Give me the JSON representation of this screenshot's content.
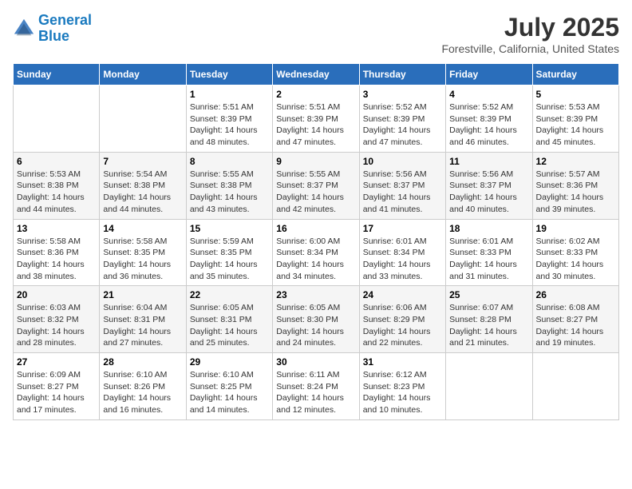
{
  "logo": {
    "line1": "General",
    "line2": "Blue"
  },
  "title": "July 2025",
  "subtitle": "Forestville, California, United States",
  "weekdays": [
    "Sunday",
    "Monday",
    "Tuesday",
    "Wednesday",
    "Thursday",
    "Friday",
    "Saturday"
  ],
  "weeks": [
    [
      {
        "day": "",
        "sunrise": "",
        "sunset": "",
        "daylight": ""
      },
      {
        "day": "",
        "sunrise": "",
        "sunset": "",
        "daylight": ""
      },
      {
        "day": "1",
        "sunrise": "Sunrise: 5:51 AM",
        "sunset": "Sunset: 8:39 PM",
        "daylight": "Daylight: 14 hours and 48 minutes."
      },
      {
        "day": "2",
        "sunrise": "Sunrise: 5:51 AM",
        "sunset": "Sunset: 8:39 PM",
        "daylight": "Daylight: 14 hours and 47 minutes."
      },
      {
        "day": "3",
        "sunrise": "Sunrise: 5:52 AM",
        "sunset": "Sunset: 8:39 PM",
        "daylight": "Daylight: 14 hours and 47 minutes."
      },
      {
        "day": "4",
        "sunrise": "Sunrise: 5:52 AM",
        "sunset": "Sunset: 8:39 PM",
        "daylight": "Daylight: 14 hours and 46 minutes."
      },
      {
        "day": "5",
        "sunrise": "Sunrise: 5:53 AM",
        "sunset": "Sunset: 8:39 PM",
        "daylight": "Daylight: 14 hours and 45 minutes."
      }
    ],
    [
      {
        "day": "6",
        "sunrise": "Sunrise: 5:53 AM",
        "sunset": "Sunset: 8:38 PM",
        "daylight": "Daylight: 14 hours and 44 minutes."
      },
      {
        "day": "7",
        "sunrise": "Sunrise: 5:54 AM",
        "sunset": "Sunset: 8:38 PM",
        "daylight": "Daylight: 14 hours and 44 minutes."
      },
      {
        "day": "8",
        "sunrise": "Sunrise: 5:55 AM",
        "sunset": "Sunset: 8:38 PM",
        "daylight": "Daylight: 14 hours and 43 minutes."
      },
      {
        "day": "9",
        "sunrise": "Sunrise: 5:55 AM",
        "sunset": "Sunset: 8:37 PM",
        "daylight": "Daylight: 14 hours and 42 minutes."
      },
      {
        "day": "10",
        "sunrise": "Sunrise: 5:56 AM",
        "sunset": "Sunset: 8:37 PM",
        "daylight": "Daylight: 14 hours and 41 minutes."
      },
      {
        "day": "11",
        "sunrise": "Sunrise: 5:56 AM",
        "sunset": "Sunset: 8:37 PM",
        "daylight": "Daylight: 14 hours and 40 minutes."
      },
      {
        "day": "12",
        "sunrise": "Sunrise: 5:57 AM",
        "sunset": "Sunset: 8:36 PM",
        "daylight": "Daylight: 14 hours and 39 minutes."
      }
    ],
    [
      {
        "day": "13",
        "sunrise": "Sunrise: 5:58 AM",
        "sunset": "Sunset: 8:36 PM",
        "daylight": "Daylight: 14 hours and 38 minutes."
      },
      {
        "day": "14",
        "sunrise": "Sunrise: 5:58 AM",
        "sunset": "Sunset: 8:35 PM",
        "daylight": "Daylight: 14 hours and 36 minutes."
      },
      {
        "day": "15",
        "sunrise": "Sunrise: 5:59 AM",
        "sunset": "Sunset: 8:35 PM",
        "daylight": "Daylight: 14 hours and 35 minutes."
      },
      {
        "day": "16",
        "sunrise": "Sunrise: 6:00 AM",
        "sunset": "Sunset: 8:34 PM",
        "daylight": "Daylight: 14 hours and 34 minutes."
      },
      {
        "day": "17",
        "sunrise": "Sunrise: 6:01 AM",
        "sunset": "Sunset: 8:34 PM",
        "daylight": "Daylight: 14 hours and 33 minutes."
      },
      {
        "day": "18",
        "sunrise": "Sunrise: 6:01 AM",
        "sunset": "Sunset: 8:33 PM",
        "daylight": "Daylight: 14 hours and 31 minutes."
      },
      {
        "day": "19",
        "sunrise": "Sunrise: 6:02 AM",
        "sunset": "Sunset: 8:33 PM",
        "daylight": "Daylight: 14 hours and 30 minutes."
      }
    ],
    [
      {
        "day": "20",
        "sunrise": "Sunrise: 6:03 AM",
        "sunset": "Sunset: 8:32 PM",
        "daylight": "Daylight: 14 hours and 28 minutes."
      },
      {
        "day": "21",
        "sunrise": "Sunrise: 6:04 AM",
        "sunset": "Sunset: 8:31 PM",
        "daylight": "Daylight: 14 hours and 27 minutes."
      },
      {
        "day": "22",
        "sunrise": "Sunrise: 6:05 AM",
        "sunset": "Sunset: 8:31 PM",
        "daylight": "Daylight: 14 hours and 25 minutes."
      },
      {
        "day": "23",
        "sunrise": "Sunrise: 6:05 AM",
        "sunset": "Sunset: 8:30 PM",
        "daylight": "Daylight: 14 hours and 24 minutes."
      },
      {
        "day": "24",
        "sunrise": "Sunrise: 6:06 AM",
        "sunset": "Sunset: 8:29 PM",
        "daylight": "Daylight: 14 hours and 22 minutes."
      },
      {
        "day": "25",
        "sunrise": "Sunrise: 6:07 AM",
        "sunset": "Sunset: 8:28 PM",
        "daylight": "Daylight: 14 hours and 21 minutes."
      },
      {
        "day": "26",
        "sunrise": "Sunrise: 6:08 AM",
        "sunset": "Sunset: 8:27 PM",
        "daylight": "Daylight: 14 hours and 19 minutes."
      }
    ],
    [
      {
        "day": "27",
        "sunrise": "Sunrise: 6:09 AM",
        "sunset": "Sunset: 8:27 PM",
        "daylight": "Daylight: 14 hours and 17 minutes."
      },
      {
        "day": "28",
        "sunrise": "Sunrise: 6:10 AM",
        "sunset": "Sunset: 8:26 PM",
        "daylight": "Daylight: 14 hours and 16 minutes."
      },
      {
        "day": "29",
        "sunrise": "Sunrise: 6:10 AM",
        "sunset": "Sunset: 8:25 PM",
        "daylight": "Daylight: 14 hours and 14 minutes."
      },
      {
        "day": "30",
        "sunrise": "Sunrise: 6:11 AM",
        "sunset": "Sunset: 8:24 PM",
        "daylight": "Daylight: 14 hours and 12 minutes."
      },
      {
        "day": "31",
        "sunrise": "Sunrise: 6:12 AM",
        "sunset": "Sunset: 8:23 PM",
        "daylight": "Daylight: 14 hours and 10 minutes."
      },
      {
        "day": "",
        "sunrise": "",
        "sunset": "",
        "daylight": ""
      },
      {
        "day": "",
        "sunrise": "",
        "sunset": "",
        "daylight": ""
      }
    ]
  ]
}
